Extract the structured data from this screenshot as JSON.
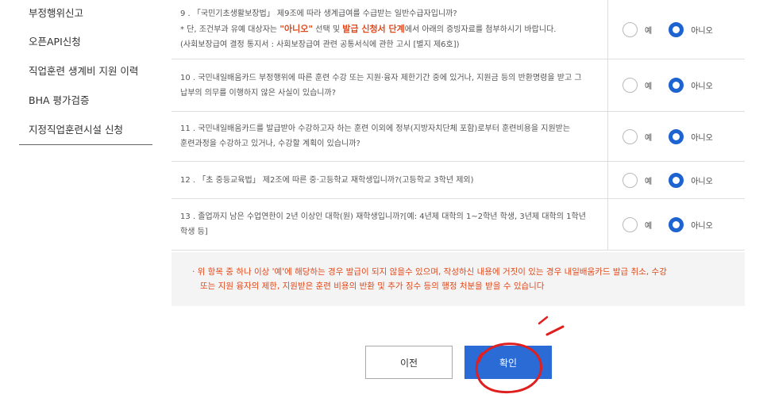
{
  "sidebar": {
    "items": [
      {
        "label": "부정행위신고"
      },
      {
        "label": "오픈API신청"
      },
      {
        "label": "직업훈련 생계비 지원 이력"
      },
      {
        "label": "BHA 평가검증"
      },
      {
        "label": "지정직업훈련시설 신청"
      }
    ]
  },
  "options": {
    "yes": "예",
    "no": "아니오"
  },
  "questions": [
    {
      "line1": "9 . 「국민기초생활보장법」 제9조에 따라 생계급여를 수급받는 일반수급자입니까?",
      "line2_pre": "* 단, 조건부과 유예 대상자는 ",
      "line2_hl1": "\"아니오\"",
      "line2_mid": " 선택 및 ",
      "line2_hl2": "발급 신청서 단계",
      "line2_post": "에서 아래의 증빙자료를 첨부하시기 바랍니다.",
      "line3": "(사회보장급여 결정 통지서 : 사회보장급여 관련 공통서식에 관한 고시 [별지 제6호])",
      "selected": "no"
    },
    {
      "line1": "10 . 국민내일배움카드 부정행위에 따른 훈련 수강 또는 지원·융자 제한기간 중에 있거나, 지원금 등의 반환명령을 받고 그",
      "line2": "납부의 의무를 이행하지 않은 사실이 있습니까?",
      "selected": "no"
    },
    {
      "line1": "11 . 국민내일배움카드를 발급받아 수강하고자 하는 훈련 이외에 정부(지방자치단체 포함)로부터 훈련비용을 지원받는",
      "line2": "훈련과정을 수강하고 있거나, 수강할 계획이 있습니까?",
      "selected": "no"
    },
    {
      "line1": "12 . 「초 중등교육법」 제2조에 따른 중·고등학교 재학생입니까?(고등학교 3학년 제외)",
      "selected": "no"
    },
    {
      "line1": "13 . 졸업까지 남은 수업연한이 2년 이상인 대학(원) 재학생입니까?[예: 4년제 대학의 1~2학년 학생, 3년제 대학의 1학년",
      "line2": "학생 등]",
      "selected": "no"
    }
  ],
  "notice": {
    "line1": "· 위 항목 중 하나 이상 '예'에 해당하는 경우 발급이 되지 않을수 있으며, 작성하신 내용에 거짓이 있는 경우 내일배움카드 발급 취소, 수강",
    "line2": "또는 지원 융자의 제한, 지원받은 훈련 비용의 반환 및 추가 징수 등의 행정 처분을 받을 수 있습니다"
  },
  "buttons": {
    "prev": "이전",
    "confirm": "확인"
  },
  "colors": {
    "accent": "#2a6bd6",
    "warning": "#e0491b",
    "annotation": "#e02020"
  }
}
